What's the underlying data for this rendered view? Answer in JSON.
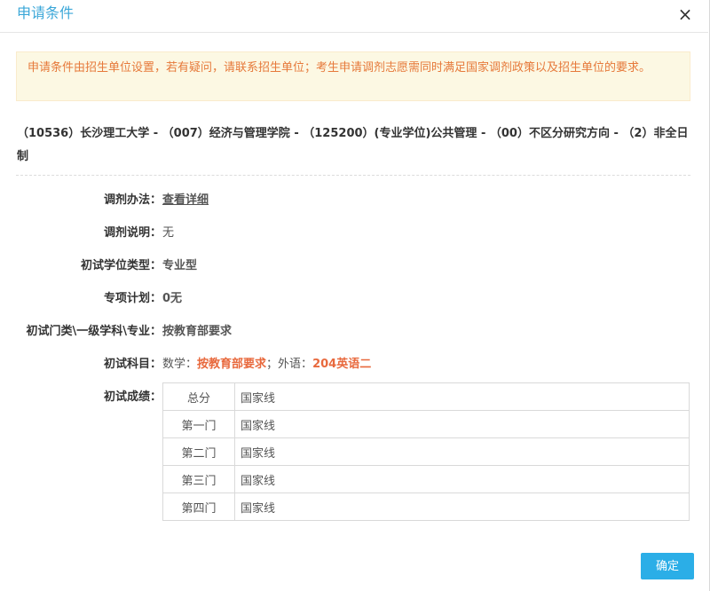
{
  "dialog": {
    "title": "申请条件",
    "close_glyph": "×"
  },
  "notice": "申请条件由招生单位设置，若有疑问，请联系招生单位；考生申请调剂志愿需同时满足国家调剂政策以及招生单位的要求。",
  "program": "（10536）长沙理工大学 - （007）经济与管理学院 - （125200）(专业学位)公共管理 - （00）不区分研究方向 - （2）非全日制",
  "fields": {
    "method": {
      "label": "调剂办法：",
      "value": "查看详细"
    },
    "note": {
      "label": "调剂说明：",
      "value": "无"
    },
    "degree_type": {
      "label": "初试学位类型：",
      "value": "专业型"
    },
    "special_plan": {
      "label": "专项计划：",
      "value": "0无"
    },
    "category": {
      "label": "初试门类\\一级学科\\专业：",
      "value": "按教育部要求"
    },
    "subjects": {
      "label": "初试科目：",
      "math_label": "数学：",
      "math_value": "按教育部要求",
      "separator": "；",
      "foreign_label": "外语：",
      "foreign_value": "204英语二"
    },
    "scores_label": "初试成绩："
  },
  "scores": [
    {
      "name": "总分",
      "value": "国家线"
    },
    {
      "name": "第一门",
      "value": "国家线"
    },
    {
      "name": "第二门",
      "value": "国家线"
    },
    {
      "name": "第三门",
      "value": "国家线"
    },
    {
      "name": "第四门",
      "value": "国家线"
    }
  ],
  "confirm_label": "确定",
  "colors": {
    "title": "#3ba7d8",
    "notice_text": "#e6793a",
    "notice_bg": "#fcf8e3",
    "highlight": "#e8693d",
    "link": "#1a8cd8",
    "button": "#2baee7"
  }
}
